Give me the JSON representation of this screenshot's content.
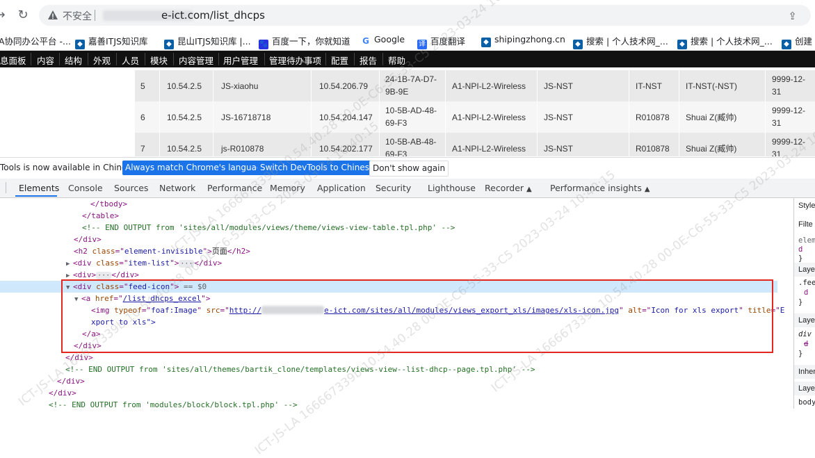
{
  "browser": {
    "insecure_label": "不安全",
    "url_visible": "e-ict.com/list_dhcps",
    "bookmarks": [
      {
        "label": "A协同办公平台 -...",
        "icon": "app-icon",
        "color": "#d93025"
      },
      {
        "label": "嘉善ITJS知识库",
        "icon": "drupal-icon",
        "color": "#0b5fa5"
      },
      {
        "label": "昆山ITJS知识库 |...",
        "icon": "drupal-icon",
        "color": "#0b5fa5"
      },
      {
        "label": "百度一下，你就知道",
        "icon": "baidu-icon",
        "color": "#2932e1"
      },
      {
        "label": "Google",
        "icon": "google-icon",
        "color": "#4285f4"
      },
      {
        "label": "百度翻译",
        "icon": "translate-icon",
        "color": "#2a6af6"
      },
      {
        "label": "shipingzhong.cn",
        "icon": "drupal-icon",
        "color": "#0b5fa5"
      },
      {
        "label": "搜索 | 个人技术网_...",
        "icon": "drupal-icon",
        "color": "#0b5fa5"
      },
      {
        "label": "搜索 | 个人技术网_...",
        "icon": "drupal-icon",
        "color": "#0b5fa5"
      },
      {
        "label": "创建",
        "icon": "drupal-icon",
        "color": "#0b5fa5"
      }
    ]
  },
  "site_nav": [
    "息面板",
    "内容",
    "结构",
    "外观",
    "人员",
    "模块",
    "内容管理",
    "用户管理",
    "管理待办事项",
    "配置",
    "报告",
    "帮助"
  ],
  "table": {
    "rows": [
      {
        "num": "5",
        "subnet": "10.54.2.5",
        "name": "JS-xiaohu",
        "ip": "10.54.206.79",
        "mac1": "24-1B-7A-D7-",
        "mac2": "9B-9E",
        "policy": "A1-NPI-L2-Wireless",
        "dept": "JS-NST",
        "owner": "IT-NST",
        "owner2": "IT-NST(-NST)",
        "exp1": "9999-12-",
        "exp2": "31"
      },
      {
        "num": "6",
        "subnet": "10.54.2.5",
        "name": "JS-16718718",
        "ip": "10.54.204.147",
        "mac1": "10-5B-AD-48-",
        "mac2": "69-F3",
        "policy": "A1-NPI-L2-Wireless",
        "dept": "JS-NST",
        "owner": "R010878",
        "owner2": "Shuai Z(臧帅)",
        "exp1": "9999-12-",
        "exp2": "31"
      },
      {
        "num": "7",
        "subnet": "10.54.2.5",
        "name": "js-R010878",
        "ip": "10.54.202.177",
        "mac1": "10-5B-AB-48-",
        "mac2": "69-F3",
        "policy": "A1-NPI-L2-Wireless",
        "dept": "JS-NST",
        "owner": "R010878",
        "owner2": "Shuai Z(臧帅)",
        "exp1": "9999-12-",
        "exp2": "31"
      }
    ]
  },
  "lang_banner": {
    "message": "Tools is now available in Chinese!",
    "btn_always": "Always match Chrome's language",
    "btn_switch": "Switch DevTools to Chinese",
    "btn_dont": "Don't show again"
  },
  "devtools_tabs": [
    "Elements",
    "Console",
    "Sources",
    "Network",
    "Performance",
    "Memory",
    "Application",
    "Security",
    "Lighthouse",
    "Recorder",
    "Performance insights"
  ],
  "dom": {
    "l1": "</tbody>",
    "l2": "</table>",
    "l3": "<!-- END OUTPUT from 'sites/all/modules/views/theme/views-view-table.tpl.php' -->",
    "l4": "</div>",
    "l5_attr": "element-invisible",
    "l5_text": "页面",
    "l6_attr": "item-list",
    "l7": "<div>",
    "l8_attr": "feed-icon",
    "l8_eq": "== $0",
    "l9_href": "/list_dhcps_excel",
    "l10_typeof": "foaf:Image",
    "l10_src_a": "http://",
    "l10_src_b": "e-ict.com/sites/all/modules/views_export_xls/images/xls-icon.jpg",
    "l10_alt": "Icon for xls export",
    "l10_title": "E",
    "l11": "xport to xls\">",
    "l12": "</a>",
    "l13": "</div>",
    "l14": "</div>",
    "l15": "<!-- END OUTPUT from 'sites/all/themes/bartik_clone/templates/views-view--list-dhcp--page.tpl.php' -->",
    "l16": "</div>",
    "l17": "</div>",
    "l18": "<!-- END OUTPUT from 'modules/block/block.tpl.php' -->"
  },
  "styles_pane": {
    "tab": "Style",
    "filter": "Filte",
    "element": "elem",
    "layer1": "Layer",
    "rule1": ".fee",
    "layer2": "Layer",
    "rule2": "div",
    "inherited": "Inher",
    "layer3": "Layer",
    "body": "body"
  },
  "watermark": "ICT-JS-LA 166667339b 10.54.40.28 00-0E-C6-55-33-C5 2023-03-24 10:40:15"
}
